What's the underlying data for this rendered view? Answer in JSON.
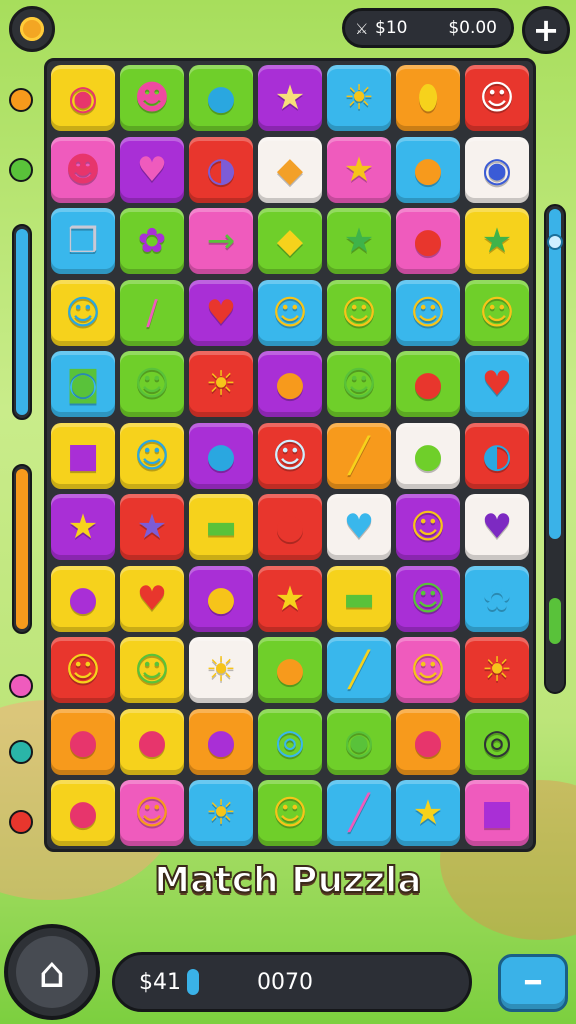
{
  "colors": {
    "yellow": "#f6d21c",
    "green": "#6fcf2a",
    "purple": "#a92fd6",
    "blue": "#39b7ec",
    "orange": "#f79a1c",
    "red": "#e8362d",
    "pink": "#ef5bbd",
    "white": "#f7f2ee",
    "lightpink": "#f7c8e6"
  },
  "header": {
    "currency_icon": "sword-icon",
    "currency_a": "$10",
    "currency_b": "$0.00",
    "plus_label": "+"
  },
  "title": "Match Puzzla",
  "footer": {
    "left_value": "$41",
    "right_value": "0070",
    "home_icon": "home-icon",
    "menu_icon": "hammer-icon"
  },
  "grid": [
    [
      [
        "yellow",
        "◉",
        "#e7356c"
      ],
      [
        "green",
        "☻",
        "#ee4aa0"
      ],
      [
        "green",
        "●",
        "#2aa7e0"
      ],
      [
        "purple",
        "★",
        "#f7e07a"
      ],
      [
        "blue",
        "☀",
        "#f6c41a"
      ],
      [
        "orange",
        "⬮",
        "#f6d21c"
      ],
      [
        "red",
        "☺",
        "#ffffff"
      ]
    ],
    [
      [
        "pink",
        "☻",
        "#e7356c"
      ],
      [
        "purple",
        "♥",
        "#ef5bbd"
      ],
      [
        "red",
        "◑",
        "#7d5cd6"
      ],
      [
        "white",
        "◆",
        "#f3a028"
      ],
      [
        "pink",
        "★",
        "#f6c41a"
      ],
      [
        "blue",
        "●",
        "#f79a1c"
      ],
      [
        "white",
        "◉",
        "#3a5bd6"
      ]
    ],
    [
      [
        "blue",
        "❒",
        "#c9c9d6"
      ],
      [
        "green",
        "✿",
        "#a92fd6"
      ],
      [
        "pink",
        "→",
        "#59c23a"
      ],
      [
        "green",
        "◆",
        "#f6d21c"
      ],
      [
        "green",
        "★",
        "#3fb34a"
      ],
      [
        "pink",
        "●",
        "#e8362d"
      ],
      [
        "yellow",
        "★",
        "#3fb34a"
      ]
    ],
    [
      [
        "yellow",
        "☺",
        "#2aa7e0"
      ],
      [
        "green",
        "∕",
        "#ef5bbd"
      ],
      [
        "purple",
        "♥",
        "#e8362d"
      ],
      [
        "blue",
        "☺",
        "#f6c41a"
      ],
      [
        "green",
        "☺",
        "#f6c41a"
      ],
      [
        "blue",
        "☺",
        "#f6c41a"
      ],
      [
        "green",
        "☺",
        "#f6c41a"
      ]
    ],
    [
      [
        "blue",
        "◙",
        "#59c23a"
      ],
      [
        "green",
        "☺",
        "#59c23a"
      ],
      [
        "red",
        "☀",
        "#f6c41a"
      ],
      [
        "purple",
        "●",
        "#f79a1c"
      ],
      [
        "green",
        "☺",
        "#59c23a"
      ],
      [
        "green",
        "●",
        "#e8362d"
      ],
      [
        "blue",
        "♥",
        "#e8362d"
      ]
    ],
    [
      [
        "yellow",
        "■",
        "#a92fd6"
      ],
      [
        "yellow",
        "☺",
        "#2aa7e0"
      ],
      [
        "purple",
        "●",
        "#2aa7e0"
      ],
      [
        "red",
        "☺",
        "#cfefff"
      ],
      [
        "orange",
        "╱",
        "#f6d21c"
      ],
      [
        "white",
        "●",
        "#6fcf2a"
      ],
      [
        "red",
        "◐",
        "#2aa7e0"
      ]
    ],
    [
      [
        "purple",
        "★",
        "#f6d21c"
      ],
      [
        "red",
        "★",
        "#7d5cd6"
      ],
      [
        "yellow",
        "▬",
        "#59c23a"
      ],
      [
        "red",
        "●",
        "#e8362d"
      ],
      [
        "white",
        "♥",
        "#39b7ec"
      ],
      [
        "purple",
        "☺",
        "#f6c41a"
      ],
      [
        "white",
        "♥",
        "#7d2ac2"
      ]
    ],
    [
      [
        "yellow",
        "●",
        "#a92fd6"
      ],
      [
        "yellow",
        "♥",
        "#e8362d"
      ],
      [
        "purple",
        "●",
        "#f6c41a"
      ],
      [
        "red",
        "★",
        "#f6d21c"
      ],
      [
        "yellow",
        "▬",
        "#59c23a"
      ],
      [
        "purple",
        "☺",
        "#59c23a"
      ],
      [
        "blue",
        "✿",
        "#39b7ec"
      ]
    ],
    [
      [
        "red",
        "☺",
        "#f6d21c"
      ],
      [
        "yellow",
        "☺",
        "#59c23a"
      ],
      [
        "white",
        "☀",
        "#f6c41a"
      ],
      [
        "green",
        "●",
        "#f79a1c"
      ],
      [
        "blue",
        "╱",
        "#f6d21c"
      ],
      [
        "pink",
        "☺",
        "#f6c41a"
      ],
      [
        "red",
        "☀",
        "#f6c41a"
      ]
    ],
    [
      [
        "orange",
        "●",
        "#e7356c"
      ],
      [
        "yellow",
        "●",
        "#e7356c"
      ],
      [
        "orange",
        "●",
        "#a92fd6"
      ],
      [
        "green",
        "◎",
        "#39b7ec"
      ],
      [
        "green",
        "◉",
        "#59c23a"
      ],
      [
        "orange",
        "●",
        "#e7356c"
      ],
      [
        "green",
        "◎",
        "#2f3237"
      ]
    ],
    [
      [
        "yellow",
        "●",
        "#e7356c"
      ],
      [
        "pink",
        "☺",
        "#f79a1c"
      ],
      [
        "blue",
        "☀",
        "#f6c41a"
      ],
      [
        "green",
        "☺",
        "#f6c41a"
      ],
      [
        "blue",
        "╱",
        "#ef5bbd"
      ],
      [
        "blue",
        "★",
        "#f6d21c"
      ],
      [
        "pink",
        "■",
        "#a92fd6"
      ]
    ]
  ]
}
